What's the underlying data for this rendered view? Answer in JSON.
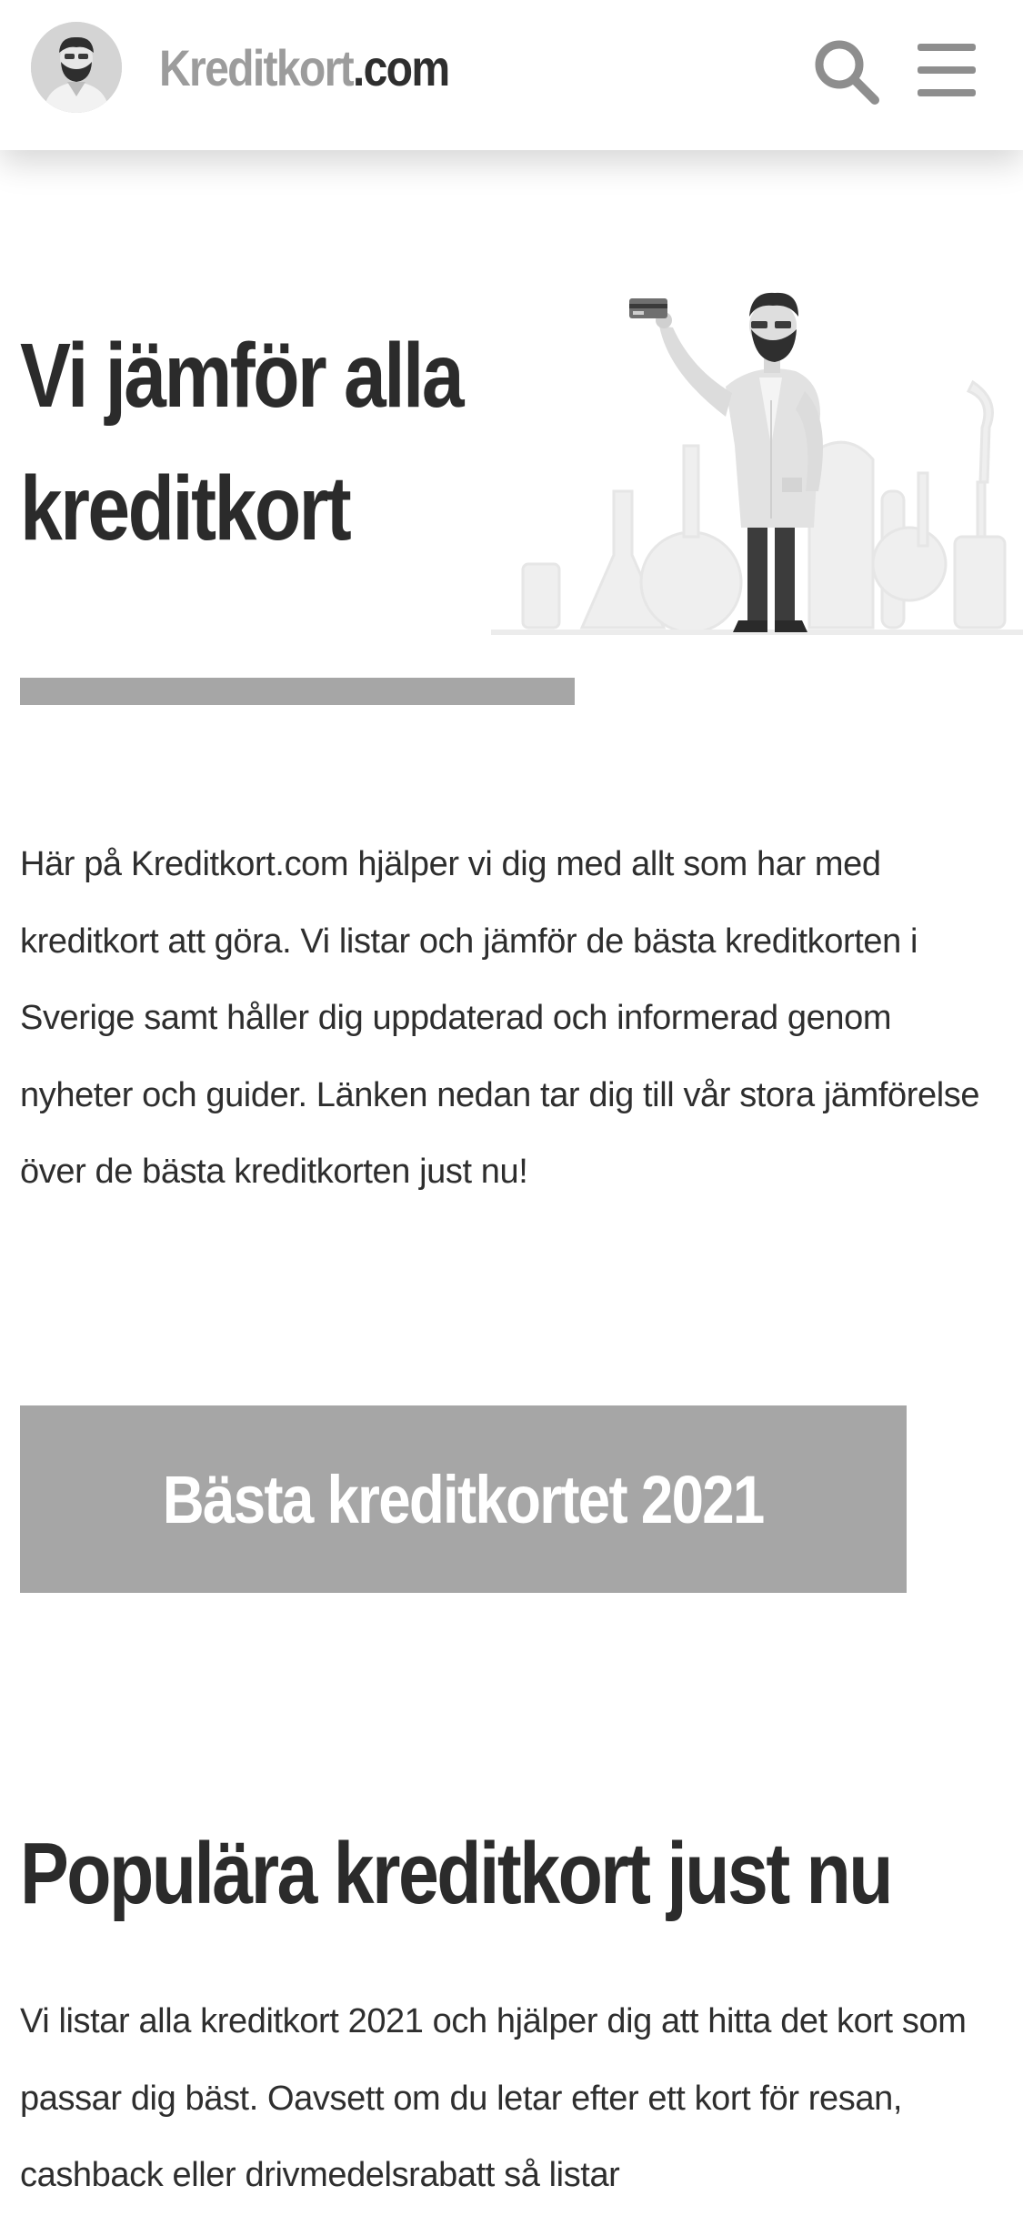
{
  "header": {
    "logo_main": "Kreditkort",
    "logo_tld": ".com",
    "avatar_icon": "bearded-man-avatar",
    "search_icon": "search-icon",
    "menu_icon": "hamburger-menu-icon"
  },
  "hero": {
    "title": "Vi jämför alla kreditkort",
    "illustration": "scientist-holding-credit-card-illustration",
    "intro": "Här på Kreditkort.com hjälper vi dig med allt som har med kreditkort att göra. Vi listar och jämför de bästa kreditkorten i Sverige samt håller dig uppdaterad och informerad genom nyheter och guider. Länken nedan tar dig till vår stora jämförelse över de bästa kreditkorten just nu!",
    "cta_label": "Bästa kreditkortet 2021"
  },
  "popular": {
    "title": "Populära kreditkort just nu",
    "text": "Vi listar alla kreditkort 2021 och hjälper dig att hitta det kort som passar dig bäst. Oavsett om du letar efter ett kort för resan, cashback eller drivmedelsrabatt så listar"
  },
  "colors": {
    "accent_gray": "#a6a6a6",
    "text_dark": "#2b2b2b",
    "background": "#ffffff"
  }
}
